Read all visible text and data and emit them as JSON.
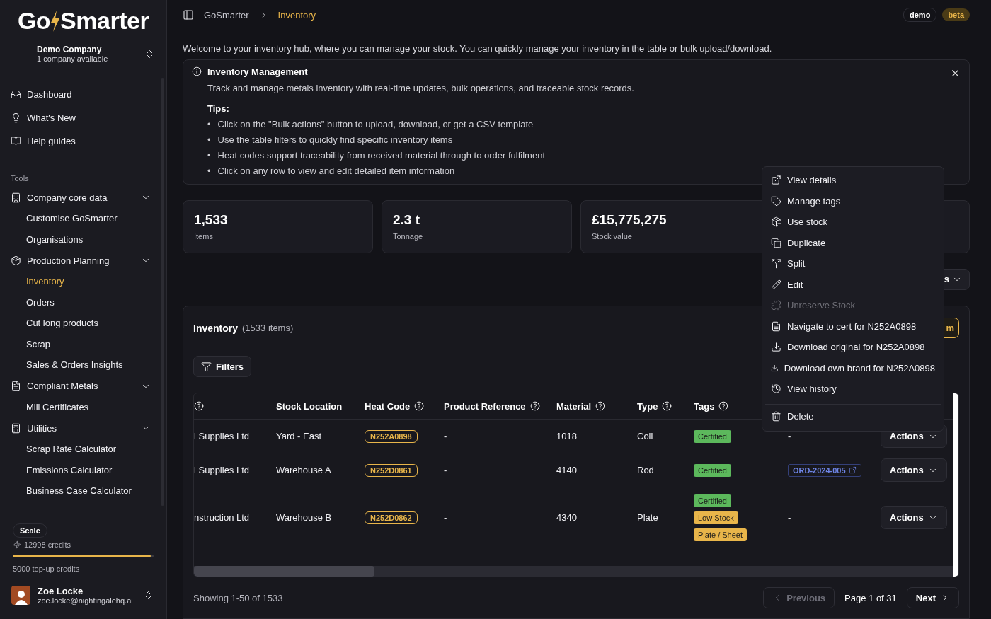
{
  "sidebar": {
    "logo": {
      "first": "Go",
      "second": "Smarter"
    },
    "company": {
      "name": "Demo Company",
      "subtitle": "1 company available"
    },
    "nav": [
      {
        "label": "Dashboard",
        "selected": false
      },
      {
        "label": "What's New",
        "selected": false
      },
      {
        "label": "Help guides",
        "selected": false
      }
    ],
    "section": "Tools",
    "groups": [
      {
        "label": "Company core data",
        "expanded": true,
        "children": [
          {
            "label": "Customise GoSmarter",
            "selected": false
          },
          {
            "label": "Organisations",
            "selected": false
          }
        ]
      },
      {
        "label": "Production Planning",
        "expanded": true,
        "children": [
          {
            "label": "Inventory",
            "selected": true
          },
          {
            "label": "Orders",
            "selected": false
          },
          {
            "label": "Cut long products",
            "selected": false
          },
          {
            "label": "Scrap",
            "selected": false
          },
          {
            "label": "Sales & Orders Insights",
            "selected": false
          }
        ]
      },
      {
        "label": "Compliant Metals",
        "expanded": true,
        "children": [
          {
            "label": "Mill Certificates",
            "selected": false
          }
        ]
      },
      {
        "label": "Utilities",
        "expanded": true,
        "children": [
          {
            "label": "Scrap Rate Calculator",
            "selected": false
          },
          {
            "label": "Emissions Calculator",
            "selected": false
          },
          {
            "label": "Business Case Calculator",
            "selected": false
          }
        ]
      }
    ],
    "plan": {
      "name": "Scale",
      "credits": "12998 credits",
      "level": 0.98,
      "topup": "5000 top-up credits"
    },
    "user": {
      "name": "Zoe Locke",
      "email": "zoe.locke@nightingalehq.ai"
    }
  },
  "breadcrumb": [
    {
      "label": "GoSmarter",
      "selected": false
    },
    {
      "label": "Inventory",
      "selected": true
    }
  ],
  "badges": [
    {
      "label": "demo",
      "kind": "outline"
    },
    {
      "label": "beta",
      "kind": "accent"
    }
  ],
  "intro": "Welcome to your inventory hub, where you can manage your stock. You can quickly manage your inventory in the table or bulk upload/download.",
  "info": {
    "bullet": "•",
    "title": "Inventory Management",
    "description": "Track and manage metals inventory with real-time updates, bulk operations, and traceable stock records.",
    "tips_title": "Tips:",
    "tips": [
      "Click on the \"Bulk actions\" button to upload, download, or get a CSV template",
      "Use the table filters to quickly find specific inventory items",
      "Heat codes support traceability from received material through to order fulfilment",
      "Click on any row to view and edit detailed item information"
    ]
  },
  "stats": [
    {
      "value": "1,533",
      "label": "Items"
    },
    {
      "value": "2.3 t",
      "label": "Tonnage"
    },
    {
      "value": "£15,775,275",
      "label": "Stock value"
    }
  ],
  "bulk_button": "s",
  "inventory": {
    "title": "Inventory",
    "count": "(1533 items)",
    "add_button": "m",
    "filters": "Filters",
    "columns": [
      {
        "help": true
      },
      {
        "label": "Stock Location",
        "help": false
      },
      {
        "label": "Heat Code",
        "help": true
      },
      {
        "label": "Product Reference",
        "help": true
      },
      {
        "label": "Material",
        "help": true
      },
      {
        "label": "Type",
        "help": true
      },
      {
        "label": "Tags",
        "help": true
      }
    ],
    "rows": [
      {
        "supplier": "l Supplies Ltd",
        "location": "Yard - East",
        "heat_code": "N252A0898",
        "product_reference": "-",
        "material": "1018",
        "type": "Coil",
        "tags": [
          {
            "label": "Certified",
            "color": "#5cb85c"
          }
        ],
        "order": {
          "kind": "text",
          "label": "-"
        },
        "action": "Actions"
      },
      {
        "supplier": "l Supplies Ltd",
        "location": "Warehouse A",
        "heat_code": "N252D0861",
        "product_reference": "-",
        "material": "4140",
        "type": "Rod",
        "tags": [
          {
            "label": "Certified",
            "color": "#5cb85c"
          }
        ],
        "order": {
          "kind": "link",
          "label": "ORD-2024-005"
        },
        "action": "Actions"
      },
      {
        "supplier": "nstruction Ltd",
        "location": "Warehouse B",
        "heat_code": "N252D0862",
        "product_reference": "-",
        "material": "4340",
        "type": "Plate",
        "tags": [
          {
            "label": "Certified",
            "color": "#5cb85c"
          },
          {
            "label": "Low Stock",
            "color": "#e8b54a"
          },
          {
            "label": "Plate / Sheet",
            "color": "#e8b54a"
          }
        ],
        "order": {
          "kind": "text",
          "label": "-"
        },
        "action": "Actions"
      }
    ],
    "showing": "Showing 1-50 of 1533",
    "previous": {
      "label": "Previous",
      "disabled": true
    },
    "page": "Page 1 of 31",
    "next": {
      "label": "Next",
      "disabled": false
    }
  },
  "menu": [
    {
      "label": "View details",
      "disabled": false
    },
    {
      "label": "Manage tags",
      "disabled": false
    },
    {
      "label": "Use stock",
      "disabled": false
    },
    {
      "label": "Duplicate",
      "disabled": false
    },
    {
      "label": "Split",
      "disabled": false
    },
    {
      "label": "Edit",
      "disabled": false
    },
    {
      "label": "Unreserve Stock",
      "disabled": true
    },
    {
      "label": "Navigate to cert for N252A0898",
      "disabled": false
    },
    {
      "label": "Download original for N252A0898",
      "disabled": false
    },
    {
      "label": "Download own brand for N252A0898",
      "disabled": false
    },
    {
      "label": "View history",
      "disabled": false
    },
    {
      "label": "Delete",
      "disabled": false,
      "kind": "separated"
    }
  ]
}
